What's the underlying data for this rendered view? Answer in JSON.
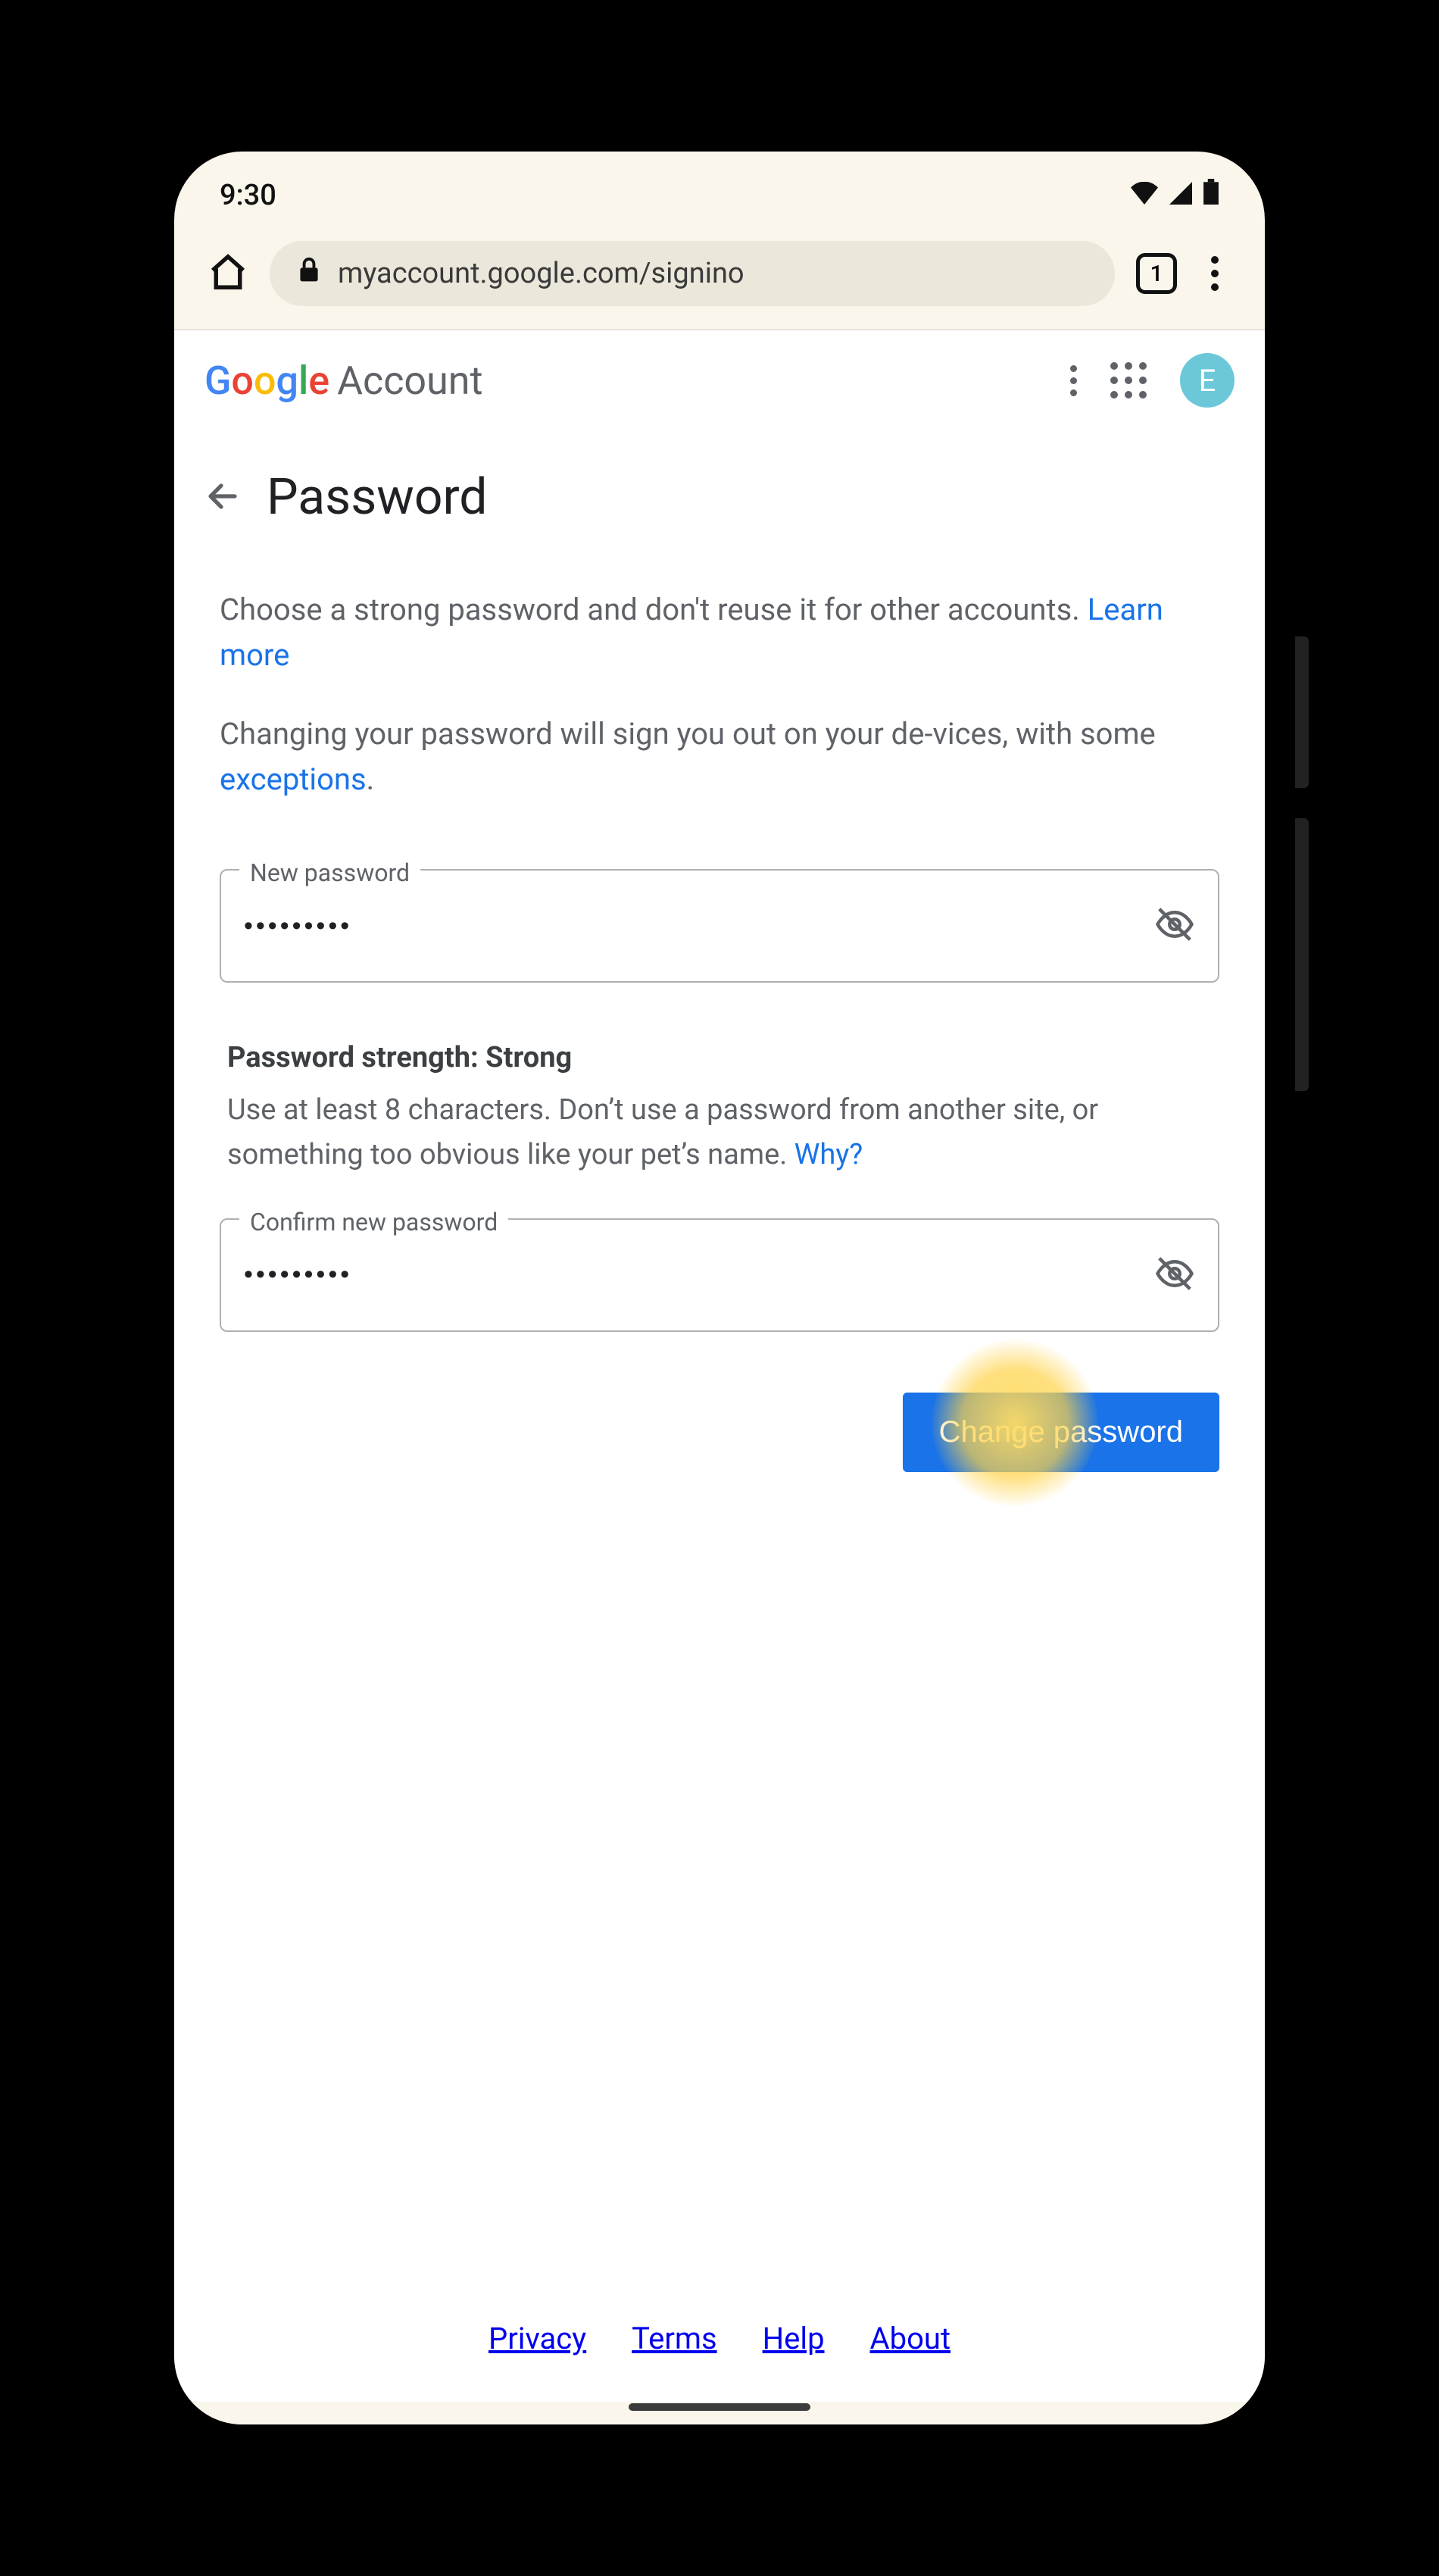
{
  "status": {
    "time": "9:30"
  },
  "browser": {
    "url": "myaccount.google.com/signino",
    "tab_count": "1"
  },
  "header": {
    "logo_letters": [
      "G",
      "o",
      "o",
      "g",
      "l",
      "e"
    ],
    "logo_suffix": "Account",
    "avatar_initial": "E"
  },
  "page": {
    "title": "Password",
    "intro_1_a": "Choose a strong password and don't reuse it for other accounts. ",
    "intro_1_link": "Learn more",
    "intro_2_a": "Changing your password will sign you out on your de-vices, with some ",
    "intro_2_link": "exceptions",
    "intro_2_b": "."
  },
  "fields": {
    "new_label": "New password",
    "new_value": "•••••••••",
    "confirm_label": "Confirm new password",
    "confirm_value": "•••••••••"
  },
  "strength": {
    "label": "Password strength: Strong",
    "hint_a": "Use at least 8 characters. Don’t use a password from another site, or something too obvious like your pet’s name. ",
    "hint_link": "Why?"
  },
  "actions": {
    "change_label": "Change password"
  },
  "footer": {
    "privacy": "Privacy",
    "terms": "Terms",
    "help": "Help",
    "about": "About"
  }
}
